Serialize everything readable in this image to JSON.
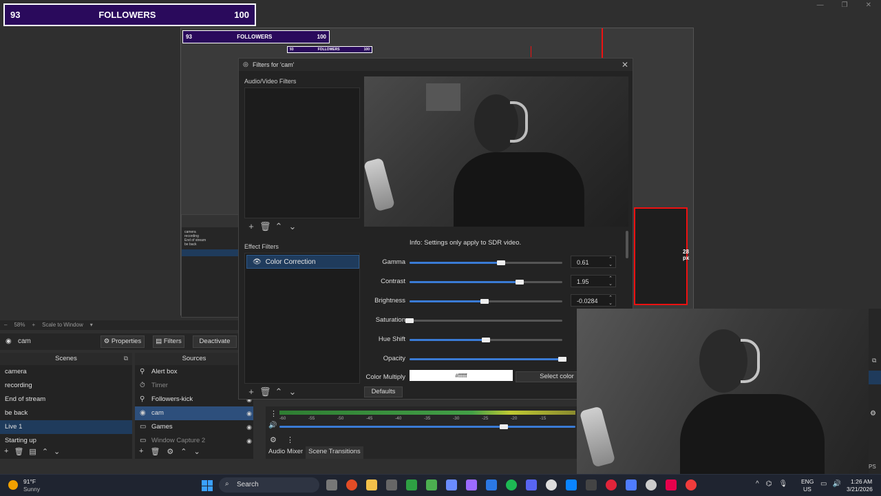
{
  "followers": {
    "current": "93",
    "label": "FOLLOWERS",
    "goal": "100"
  },
  "nested_preview": {
    "zoom": "58%",
    "scale": "Scale to Window",
    "dim_label": "28 px"
  },
  "source_toolbar": {
    "source_name": "cam",
    "properties": "Properties",
    "filters": "Filters",
    "deactivate": "Deactivate"
  },
  "scenes": {
    "header": "Scenes",
    "items": [
      "camera",
      "recording",
      "End of stream",
      "be back",
      "Live 1",
      "Starting up"
    ]
  },
  "sources": {
    "header": "Sources",
    "items": [
      "Alert box",
      "Timer",
      "Followers-kick",
      "cam",
      "Games",
      "Window Capture 2"
    ]
  },
  "dialog": {
    "title": "Filters for 'cam'",
    "av_filters_label": "Audio/Video Filters",
    "effect_filters_label": "Effect Filters",
    "effect_item": "Color Correction",
    "info": "Info: Settings only apply to SDR video.",
    "defaults": "Defaults",
    "select_color": "Select color",
    "color_hex": "#ffffff",
    "rows": {
      "gamma": {
        "label": "Gamma",
        "value": "0.61",
        "level": 0.6
      },
      "contrast": {
        "label": "Contrast",
        "value": "1.95",
        "level": 0.72
      },
      "brightness": {
        "label": "Brightness",
        "value": "-0.0284",
        "level": 0.49
      },
      "saturation": {
        "label": "Saturation",
        "level": 0.0
      },
      "hue": {
        "label": "Hue Shift",
        "level": 0.5
      },
      "opacity": {
        "label": "Opacity",
        "level": 1.0
      },
      "color_multiply": {
        "label": "Color Multiply"
      }
    }
  },
  "mixer": {
    "ticks": [
      "-60",
      "-55",
      "-50",
      "-45",
      "-40",
      "-35",
      "-30",
      "-25",
      "-20",
      "-15"
    ],
    "tab_audio": "Audio Mixer",
    "tab_transitions": "Scene Transitions"
  },
  "statusbar": {
    "ps": "PS"
  },
  "taskbar": {
    "weather_temp": "91°F",
    "weather_desc": "Sunny",
    "search": "Search",
    "lang": "ENG",
    "region": "US",
    "time": "1:26 AM",
    "date": "3/21/2026"
  },
  "colors": {
    "accent": "#3a7bd5",
    "selection": "#1f3b5c",
    "follower_bg": "#2a0a5c",
    "red_guide": "#e11111"
  }
}
